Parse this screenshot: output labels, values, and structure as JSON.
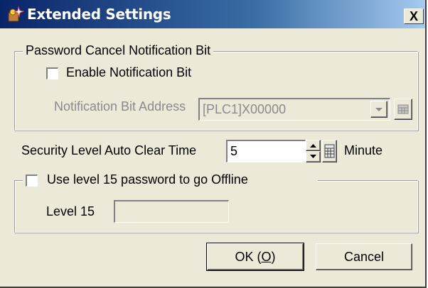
{
  "window": {
    "title": "Extended Settings",
    "close_label": "X"
  },
  "notification_group": {
    "legend": "Password Cancel Notification Bit",
    "enable_checkbox_label": "Enable Notification Bit",
    "enable_checked": false,
    "address_label": "Notification Bit Address",
    "address_value": "[PLC1]X00000"
  },
  "auto_clear": {
    "label": "Security Level Auto Clear Time",
    "value": "5",
    "unit": "Minute"
  },
  "offline_group": {
    "legend_checkbox_label": "Use level 15 password to go Offline",
    "checked": false,
    "level_label": "Level 15",
    "level_value": ""
  },
  "buttons": {
    "ok_prefix": "OK (",
    "ok_mnemonic": "O",
    "ok_suffix": ")",
    "cancel": "Cancel"
  },
  "icons": {
    "title": "settings-sparkle-icon",
    "dropdown": "chevron-down-icon",
    "keypad": "keypad-icon",
    "spinner": "spinner-arrows-icon"
  }
}
